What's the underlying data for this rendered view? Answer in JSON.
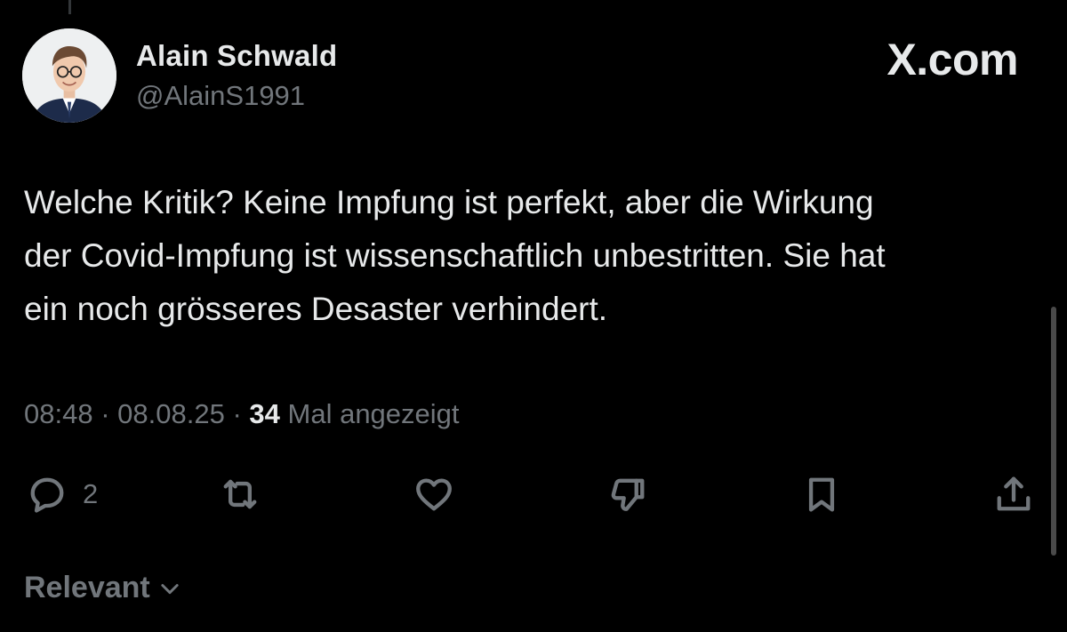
{
  "author": {
    "name": "Alain Schwald",
    "handle": "@AlainS1991"
  },
  "brand": "X.com",
  "tweet": {
    "text": "Welche Kritik? Keine Impfung ist perfekt, aber die Wirkung\nder Covid-Impfung ist wissenschaftlich unbestritten. Sie hat\nein noch grösseres Desaster verhindert."
  },
  "meta": {
    "time": "08:48",
    "separator": "·",
    "date": "08.08.25",
    "views": "34",
    "views_label": "Mal angezeigt"
  },
  "actions": {
    "reply_icon": "reply-bubble-icon",
    "reply_count": "2",
    "repost_icon": "repost-icon",
    "like_icon": "heart-icon",
    "dislike_icon": "thumbs-down-icon",
    "bookmark_icon": "bookmark-icon",
    "share_icon": "share-icon"
  },
  "sort": {
    "label": "Relevant",
    "icon": "chevron-down-icon"
  },
  "colors": {
    "background": "#000000",
    "primary_text": "#e7e9ea",
    "secondary_text": "#71767b"
  }
}
